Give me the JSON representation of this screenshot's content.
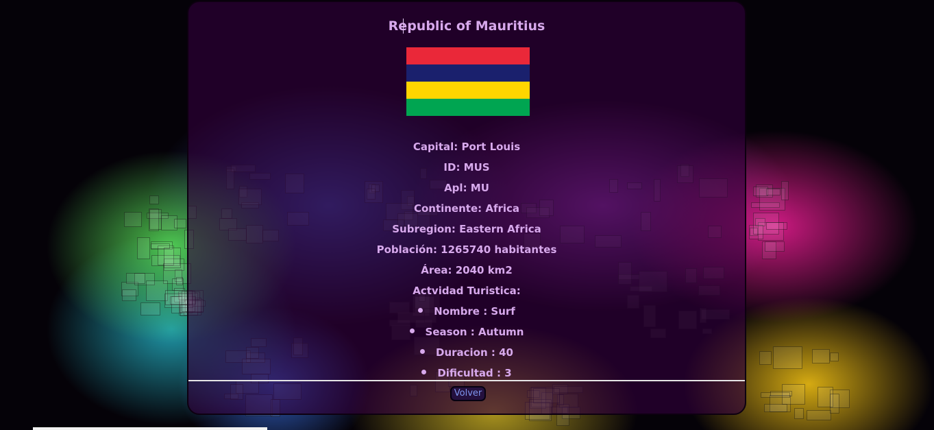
{
  "country": {
    "name": "Republic of Mauritius",
    "flag_colors": [
      "#EA2839",
      "#1A206D",
      "#FFD500",
      "#00A551"
    ],
    "details": [
      "Capital: Port Louis",
      "ID: MUS",
      "Apl: MU",
      "Continente: Africa",
      "Subregion: Eastern Africa",
      "Población: 1265740 habitantes",
      "Área: 2040 km2",
      "Actvidad Turistica:"
    ],
    "activity": [
      "Nombre : Surf",
      "Season : Autumn",
      "Duracion : 40",
      "Dificultad : 3"
    ]
  },
  "actions": {
    "back_label": "Volver"
  }
}
